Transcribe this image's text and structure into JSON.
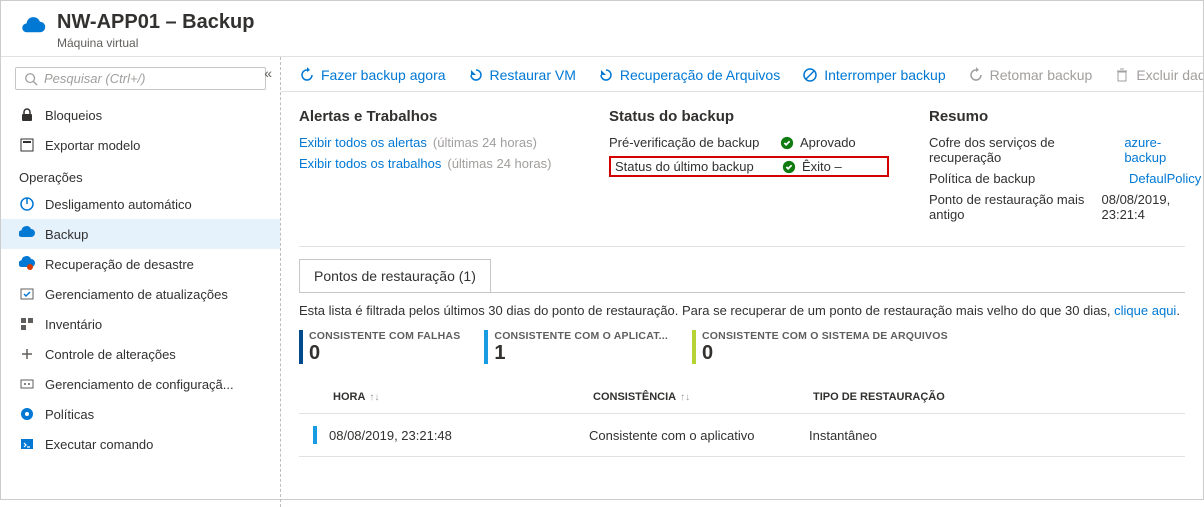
{
  "header": {
    "title": "NW-APP01 – Backup",
    "subtitle": "Máquina virtual"
  },
  "search_placeholder": "Pesquisar (Ctrl+/)",
  "sidebar": {
    "items_top": [
      {
        "label": "Bloqueios"
      },
      {
        "label": "Exportar modelo"
      }
    ],
    "section_label": "Operações",
    "items_ops": [
      {
        "label": "Desligamento automático"
      },
      {
        "label": "Backup"
      },
      {
        "label": "Recuperação de desastre"
      },
      {
        "label": "Gerenciamento de atualizações"
      },
      {
        "label": "Inventário"
      },
      {
        "label": "Controle de alterações"
      },
      {
        "label": "Gerenciamento de configuraçã..."
      },
      {
        "label": "Políticas"
      },
      {
        "label": "Executar comando"
      }
    ]
  },
  "toolbar": {
    "backup_now": "Fazer backup agora",
    "restore": "Restaurar VM",
    "file_recovery": "Recuperação de Arquivos",
    "stop": "Interromper backup",
    "resume": "Retomar backup",
    "delete": "Excluir dados de backup"
  },
  "panels": {
    "alerts": {
      "title": "Alertas e Trabalhos",
      "link1": "Exibir todos os alertas",
      "link2": "Exibir todos os trabalhos",
      "suffix": "(últimas 24 horas)"
    },
    "status": {
      "title": "Status do backup",
      "precheck_label": "Pré-verificação de backup",
      "precheck_value": "Aprovado",
      "last_label": "Status do último backup",
      "last_value": "Êxito –"
    },
    "summary": {
      "title": "Resumo",
      "vault_label": "Cofre dos serviços de recuperação",
      "vault_value": "azure-backup",
      "policy_label": "Política de backup",
      "policy_value": "DefaulPolicy",
      "oldest_label": "Ponto de restauração mais antigo",
      "oldest_value": "08/08/2019, 23:21:4"
    }
  },
  "restore_points": {
    "tab_label": "Pontos de restauração (1)",
    "filter_text": "Esta lista é filtrada pelos últimos 30 dias do ponto de restauração. Para se recuperar de um ponto de restauração mais velho do que 30 dias, ",
    "filter_link": "clique aqui",
    "consistency": [
      {
        "label": "CONSISTENTE COM FALHAS",
        "value": "0",
        "color": "#004b8d"
      },
      {
        "label": "CONSISTENTE COM O APLICAT...",
        "value": "1",
        "color": "#199be2"
      },
      {
        "label": "CONSISTENTE COM O SISTEMA DE ARQUIVOS",
        "value": "0",
        "color": "#b5d334"
      }
    ],
    "columns": {
      "time": "HORA",
      "consistency": "CONSISTÊNCIA",
      "type": "TIPO DE RESTAURAÇÃO"
    },
    "rows": [
      {
        "time": "08/08/2019, 23:21:48",
        "consistency": "Consistente com o aplicativo",
        "type": "Instantâneo"
      }
    ]
  }
}
